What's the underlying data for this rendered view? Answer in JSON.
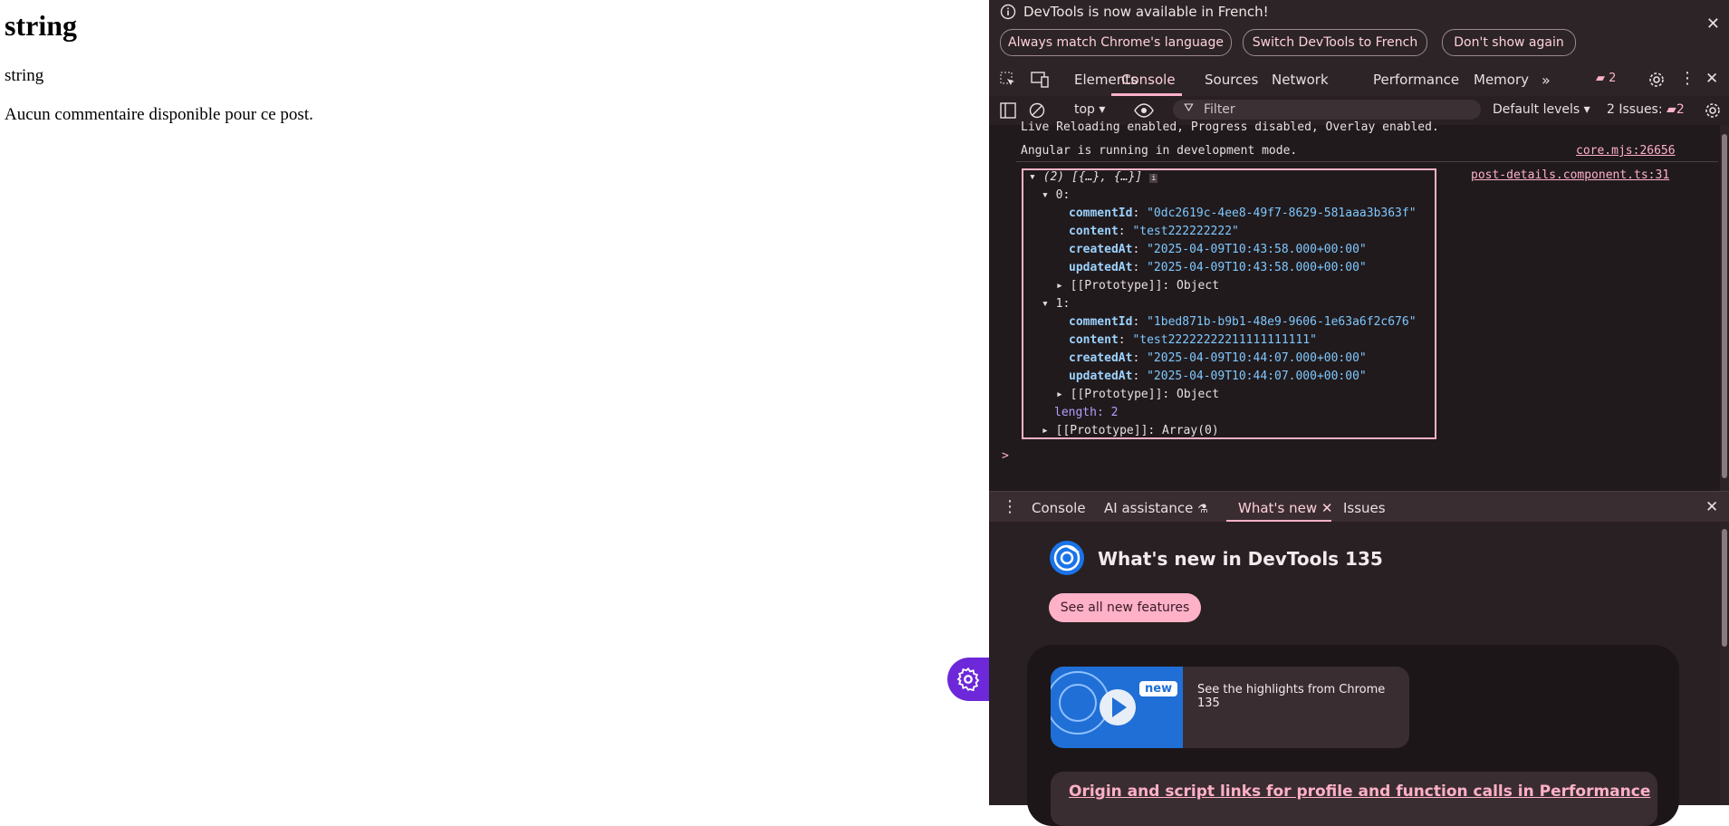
{
  "page": {
    "title": "string",
    "subtitle": "string",
    "comment_empty": "Aucun commentaire disponible pour ce post."
  },
  "devtools": {
    "infobar": {
      "message": "DevTools is now available in French!",
      "btn_match": "Always match Chrome's language",
      "btn_switch": "Switch DevTools to French",
      "btn_dont_show": "Don't show again"
    },
    "tabs": [
      "Elements",
      "Console",
      "Sources",
      "Network",
      "Performance",
      "Memory"
    ],
    "active_tab": "Console",
    "issues_badge_count": "2",
    "filterbar": {
      "context": "top",
      "filter_placeholder": "Filter",
      "levels": "Default levels",
      "issues_label": "2 Issues:",
      "issues_count": "2"
    },
    "console": {
      "line_live_reload": "Live Reloading enabled, Progress disabled, Overlay enabled.",
      "line_angular": "Angular is running in development mode.",
      "link_core": "core.mjs:26656",
      "link_post": "post-details.component.ts:31",
      "array_summary": "(2) [{…}, {…}]",
      "items": [
        {
          "index": "0:",
          "commentId": "\"0dc2619c-4ee8-49f7-8629-581aaa3b363f\"",
          "content": "\"test222222222\"",
          "createdAt": "\"2025-04-09T10:43:58.000+00:00\"",
          "updatedAt": "\"2025-04-09T10:43:58.000+00:00\""
        },
        {
          "index": "1:",
          "commentId": "\"1bed871b-b9b1-48e9-9606-1e63a6f2c676\"",
          "content": "\"test22222222211111111111\"",
          "createdAt": "\"2025-04-09T10:44:07.000+00:00\"",
          "updatedAt": "\"2025-04-09T10:44:07.000+00:00\""
        }
      ],
      "prototype_object": "[[Prototype]]: Object",
      "length_label": "length:",
      "length_value": "2",
      "prototype_array": "[[Prototype]]: Array(0)",
      "prompt": ">"
    },
    "drawer_tabs": {
      "console": "Console",
      "ai": "AI assistance",
      "whats_new": "What's new",
      "issues": "Issues"
    },
    "whats_new": {
      "title": "What's new in DevTools 135",
      "see_all": "See all new features",
      "badge_new": "new",
      "video_caption": "See the highlights from Chrome 135",
      "link_heading": "Origin and script links for profile and function calls in Performance"
    }
  }
}
